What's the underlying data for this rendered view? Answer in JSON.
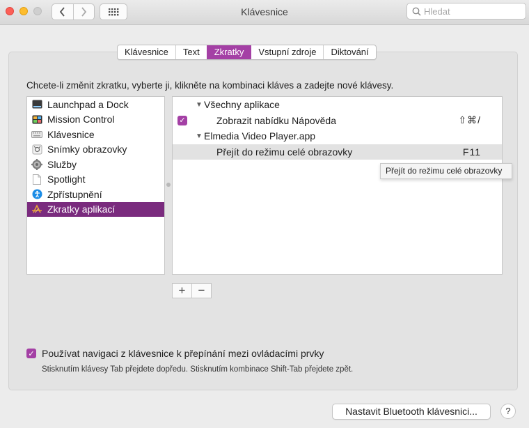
{
  "window": {
    "title": "Klávesnice",
    "search_placeholder": "Hledat"
  },
  "tabs": [
    {
      "label": "Klávesnice",
      "active": false
    },
    {
      "label": "Text",
      "active": false
    },
    {
      "label": "Zkratky",
      "active": true
    },
    {
      "label": "Vstupní zdroje",
      "active": false
    },
    {
      "label": "Diktování",
      "active": false
    }
  ],
  "instruction": "Chcete-li změnit zkratku, vyberte ji, klikněte na kombinaci kláves a zadejte nové klávesy.",
  "categories": [
    {
      "label": "Launchpad a Dock",
      "icon": "launchpad-icon"
    },
    {
      "label": "Mission Control",
      "icon": "mission-control-icon"
    },
    {
      "label": "Klávesnice",
      "icon": "keyboard-icon"
    },
    {
      "label": "Snímky obrazovky",
      "icon": "screenshot-icon"
    },
    {
      "label": "Služby",
      "icon": "gear-icon"
    },
    {
      "label": "Spotlight",
      "icon": "document-icon"
    },
    {
      "label": "Zpřístupnění",
      "icon": "accessibility-icon"
    },
    {
      "label": "Zkratky aplikací",
      "icon": "app-shortcuts-icon",
      "selected": true
    }
  ],
  "shortcuts": {
    "group1": {
      "label": "Všechny aplikace"
    },
    "item1": {
      "label": "Zobrazit nabídku Nápověda",
      "keys": "⇧⌘/",
      "checked": true
    },
    "group2": {
      "label": "Elmedia Video Player.app"
    },
    "item2": {
      "label": "Přejít do režimu celé obrazovky",
      "keys": "F11"
    }
  },
  "tooltip": "Přejít do režimu celé obrazovky",
  "buttons": {
    "add": "+",
    "remove": "−",
    "bluetooth": "Nastavit Bluetooth klávesnici...",
    "help": "?"
  },
  "keyboard_navigation": {
    "label": "Používat navigaci z klávesnice k přepínání mezi ovládacími prvky",
    "checked": true,
    "hint": "Stisknutím klávesy Tab přejdete dopředu. Stisknutím kombinace Shift-Tab přejdete zpět."
  },
  "colors": {
    "accent": "#a440a5",
    "selection": "#7a2b7e"
  }
}
